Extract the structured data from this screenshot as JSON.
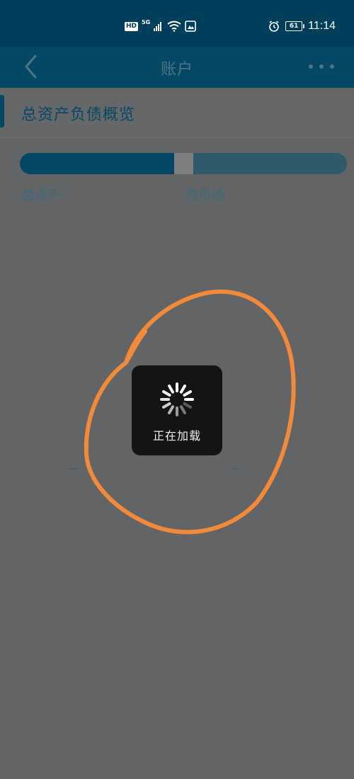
{
  "status_bar": {
    "hd": "HD",
    "network": "5G",
    "battery": "61",
    "time": "11:14"
  },
  "nav": {
    "title": "账户"
  },
  "overview": {
    "title": "总资产负债概览",
    "assets_label": "总资产",
    "liabilities_label": "总负债",
    "assets_value": "--",
    "liabilities_value": "--"
  },
  "loading": {
    "text": "正在加载"
  },
  "colors": {
    "accent": "#054866",
    "annotation_stroke": "#f28a3a"
  }
}
